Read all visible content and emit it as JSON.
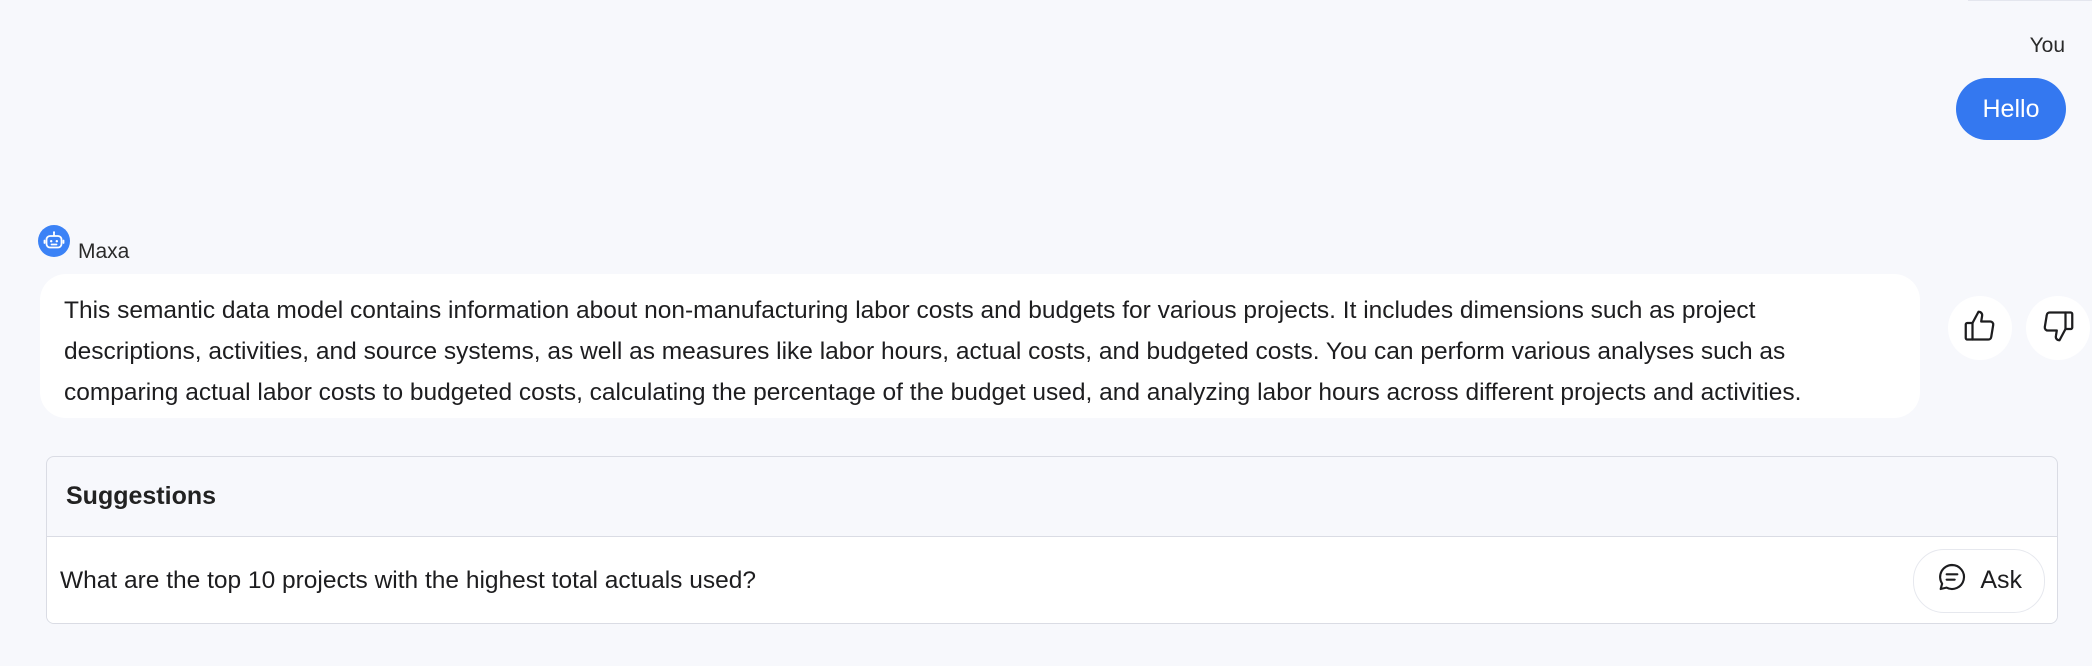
{
  "user_message": {
    "sender": "You",
    "text": "Hello"
  },
  "bot_message": {
    "sender": "Maxa",
    "text": "This semantic data model contains information about non-manufacturing labor costs and budgets for various projects. It includes dimensions such as project descriptions, activities, and source systems, as well as measures like labor hours, actual costs, and budgeted costs. You can perform various analyses such as comparing actual labor costs to budgeted costs, calculating the percentage of the budget used, and analyzing labor hours across different projects and activities.",
    "avatar_icon": "robot-icon"
  },
  "feedback": {
    "like_icon": "thumbs-up-icon",
    "dislike_icon": "thumbs-down-icon"
  },
  "suggestions": {
    "title": "Suggestions",
    "items": [
      {
        "text": "What are the top 10 projects with the highest total actuals used?",
        "button_label": "Ask",
        "button_icon": "chat-bubble-icon"
      }
    ]
  },
  "colors": {
    "background": "#f7f8fc",
    "user_bubble": "#3478f0",
    "avatar": "#3b82f6",
    "bubble": "#ffffff"
  }
}
